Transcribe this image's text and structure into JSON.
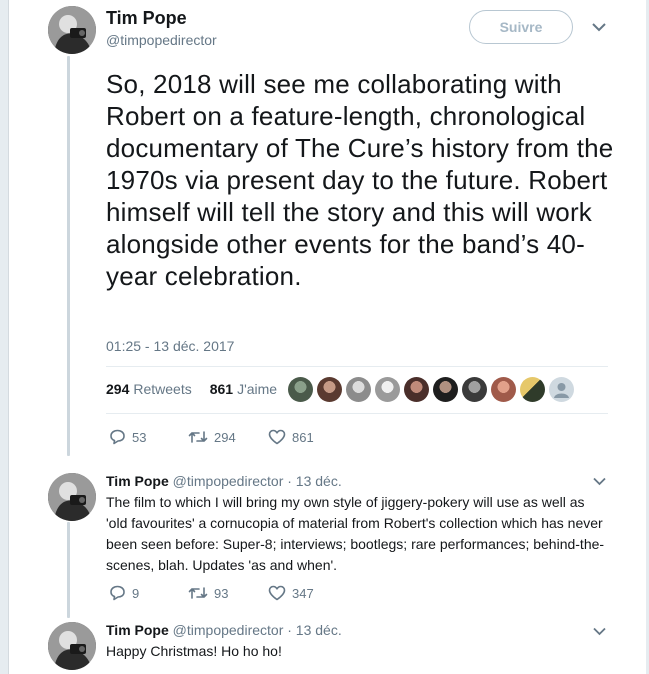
{
  "main_tweet": {
    "name": "Tim Pope",
    "handle": "@timpopedirector",
    "follow_label": "Suivre",
    "text": "So, 2018 will see me collaborating with Robert on a feature-length, chronological documentary of The Cure’s history from the 1970s via present day to the future. Robert himself will tell the story and this will work alongside other events for the band’s 40-year celebration.",
    "timestamp": "01:25 - 13 déc. 2017",
    "retweets_count": "294",
    "retweets_label": "Retweets",
    "likes_count": "861",
    "likes_label": "J'aime",
    "reply_count": "53",
    "retweet_count": "294",
    "like_count": "861"
  },
  "replies": [
    {
      "name": "Tim Pope",
      "handle": "@timpopedirector",
      "date": "· 13 déc.",
      "text": "The film to which I will bring my own style of jiggery-pokery will use as well as 'old favourites' a cornucopia of material from Robert's collection which has never been seen before: Super-8; interviews; bootlegs; rare performances; behind-the-scenes, blah. Updates 'as and when'.",
      "reply_count": "9",
      "retweet_count": "93",
      "like_count": "347"
    },
    {
      "name": "Tim Pope",
      "handle": "@timpopedirector",
      "date": "· 13 déc.",
      "text": "Happy Christmas! Ho ho ho!"
    }
  ],
  "icons": {
    "reply": "reply-icon",
    "retweet": "retweet-icon",
    "like": "heart-icon",
    "more": "chevron-down-icon"
  },
  "colors": {
    "text": "#14171a",
    "muted": "#657786",
    "border": "#e6ecf0",
    "thread_line": "#ccd6dd"
  }
}
